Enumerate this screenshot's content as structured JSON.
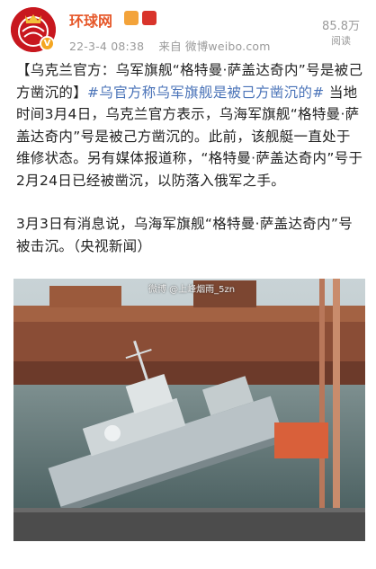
{
  "post": {
    "author": "环球网",
    "date": "22-3-4 08:38",
    "source": "来自 微博weibo.com",
    "reads_count": "85.8万",
    "reads_label": "阅读"
  },
  "content": {
    "p1_headline": "【乌克兰官方：乌军旗舰“格特曼·萨盖达奇内”号是被己方凿沉的】",
    "p1_hashtag": "#乌官方称乌军旗舰是被己方凿沉的#",
    "p1_body": " 当地时间3月4日，乌克兰官方表示，乌海军旗舰“格特曼·萨盖达奇内”号是被己方凿沉的。此前，该舰艇一直处于维修状态。另有媒体报道称，“格特曼·萨盖达奇内”号于2月24日已经被凿沉，以防落入俄军之手。",
    "p2": "3月3日有消息说，乌海军旗舰“格特曼·萨盖达奇内”号被击沉。（央视新闻）"
  },
  "image": {
    "watermark": "微博 @上峰烟雨_5zn"
  }
}
